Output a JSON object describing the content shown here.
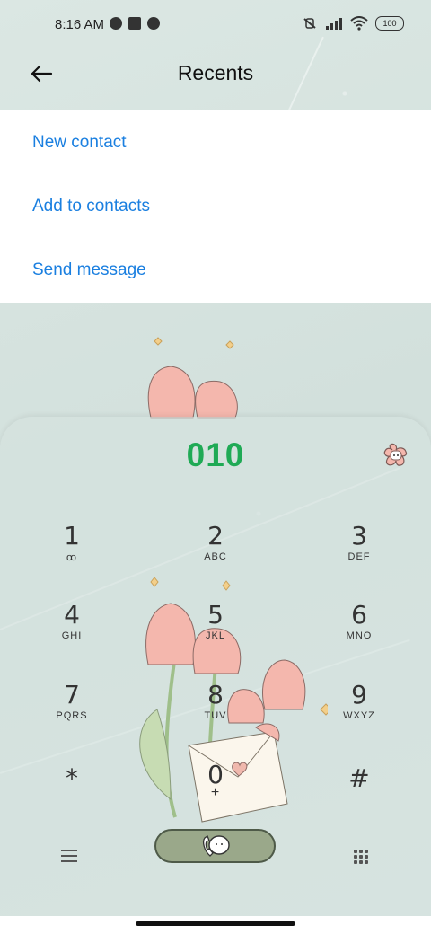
{
  "status_bar": {
    "time": "8:16 AM",
    "battery": "100"
  },
  "header": {
    "title": "Recents"
  },
  "menu": {
    "items": [
      "New contact",
      "Add to contacts",
      "Send message"
    ]
  },
  "dialer": {
    "number": "010",
    "keys": [
      {
        "digit": "1",
        "letters": "ꝏ"
      },
      {
        "digit": "2",
        "letters": "ABC"
      },
      {
        "digit": "3",
        "letters": "DEF"
      },
      {
        "digit": "4",
        "letters": "GHI"
      },
      {
        "digit": "5",
        "letters": "JKL"
      },
      {
        "digit": "6",
        "letters": "MNO"
      },
      {
        "digit": "7",
        "letters": "PQRS"
      },
      {
        "digit": "8",
        "letters": "TUV"
      },
      {
        "digit": "9",
        "letters": "WXYZ"
      },
      {
        "digit": "*",
        "letters": ""
      },
      {
        "digit": "0",
        "letters": "+"
      },
      {
        "digit": "#",
        "letters": ""
      }
    ]
  },
  "colors": {
    "accent_blue": "#1a7fe0",
    "number_green": "#1faa55",
    "call_button": "#9aa88a"
  },
  "icons": {
    "back": "arrow-left-icon",
    "backspace": "backspace-icon",
    "call": "phone-call-icon",
    "menu": "hamburger-menu-icon",
    "dialpad": "dialpad-grid-icon"
  }
}
